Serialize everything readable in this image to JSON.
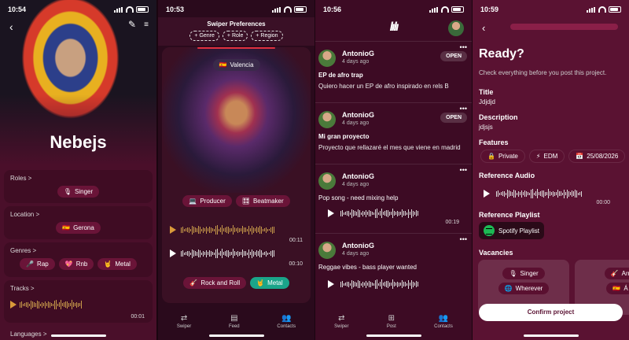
{
  "s1": {
    "time": "10:54",
    "name": "Nebejs",
    "roles_label": "Roles >",
    "roles": [
      {
        "icon": "mic-icon",
        "glyph": "🎙",
        "label": "Singer"
      }
    ],
    "location_label": "Location >",
    "location": {
      "flag": "🇪🇸",
      "label": "Gerona"
    },
    "genres_label": "Genres >",
    "genres": [
      {
        "icon": "microphone-icon",
        "glyph": "🎤",
        "label": "Rap"
      },
      {
        "icon": "heart-icon",
        "glyph": "💖",
        "label": "Rnb"
      },
      {
        "icon": "rock-hand-icon",
        "glyph": "🤘",
        "label": "Metal"
      }
    ],
    "tracks_label": "Tracks >",
    "track_duration": "00:01",
    "languages_label": "Languages >"
  },
  "s2": {
    "time": "10:53",
    "prefs_title": "Swiper Preferences",
    "pref_chips": [
      "+ Genre",
      "+ Role",
      "+ Region"
    ],
    "location": {
      "flag": "🇪🇸",
      "label": "Valencia"
    },
    "roles": [
      {
        "icon": "laptop-icon",
        "glyph": "💻",
        "label": "Producer"
      },
      {
        "icon": "grid-icon",
        "glyph": "🎛",
        "label": "Beatmaker"
      }
    ],
    "tracks": [
      {
        "duration": "00:11"
      },
      {
        "duration": "00:10"
      }
    ],
    "genres": [
      {
        "icon": "guitar-icon",
        "glyph": "🎸",
        "label": "Rock and Roll"
      },
      {
        "icon": "rock-hand-icon",
        "glyph": "🤘",
        "label": "Metal"
      }
    ],
    "tabs": [
      {
        "icon": "swap-icon",
        "glyph": "⇄",
        "label": "Swiper"
      },
      {
        "icon": "feed-icon",
        "glyph": "▤",
        "label": "Feed"
      },
      {
        "icon": "contacts-icon",
        "glyph": "👥",
        "label": "Contacts"
      }
    ]
  },
  "s3": {
    "time": "10:56",
    "logo": "lılı",
    "posts": [
      {
        "author": "AntonioG",
        "ago": "4 days ago",
        "badge": "OPEN",
        "title": "EP de afro trap",
        "text": "Quiero hacer un EP de afro inspirado en rels B"
      },
      {
        "author": "AntonioG",
        "ago": "4 days ago",
        "badge": "OPEN",
        "title": "Mi gran proyecto",
        "text": "Proyecto que rellazaré el mes que viene en madrid"
      },
      {
        "author": "AntonioG",
        "ago": "4 days ago",
        "text": "Pop song - need mixing help",
        "duration": "00:19"
      },
      {
        "author": "AntonioG",
        "ago": "4 days ago",
        "text": "Reggae vibes - bass player wanted"
      }
    ],
    "tabs": [
      {
        "icon": "swap-icon",
        "glyph": "⇄",
        "label": "Swiper"
      },
      {
        "icon": "plus-icon",
        "glyph": "⊞",
        "label": "Post"
      },
      {
        "icon": "contacts-icon",
        "glyph": "👥",
        "label": "Contacts"
      }
    ]
  },
  "s4": {
    "time": "10:59",
    "heading": "Ready?",
    "subtitle": "Check everything before you post this project.",
    "title_label": "Title",
    "title_value": "Jdjdjd",
    "desc_label": "Description",
    "desc_value": "jdjsjs",
    "features_label": "Features",
    "features": [
      {
        "icon": "lock-icon",
        "glyph": "🔒",
        "label": "Private"
      },
      {
        "icon": "bolt-icon",
        "glyph": "⚡",
        "label": "EDM"
      },
      {
        "icon": "calendar-icon",
        "glyph": "📅",
        "label": "25/08/2026"
      }
    ],
    "ref_audio_label": "Reference Audio",
    "ref_audio_duration": "00:00",
    "ref_playlist_label": "Reference Playlist",
    "playlist_label": "Spotify Playlist",
    "vacancies_label": "Vacancies",
    "vacancies": [
      {
        "role": {
          "icon": "mic-icon",
          "glyph": "🎙",
          "label": "Singer"
        },
        "region": {
          "icon": "globe-icon",
          "glyph": "🌐",
          "label": "Wherever"
        }
      },
      {
        "role": {
          "icon": "guitar-icon",
          "glyph": "🎸",
          "label": "Arr"
        },
        "region": {
          "icon": "flag-icon",
          "glyph": "🇪🇸",
          "label": "Á"
        }
      }
    ],
    "confirm_label": "Confirm project"
  }
}
